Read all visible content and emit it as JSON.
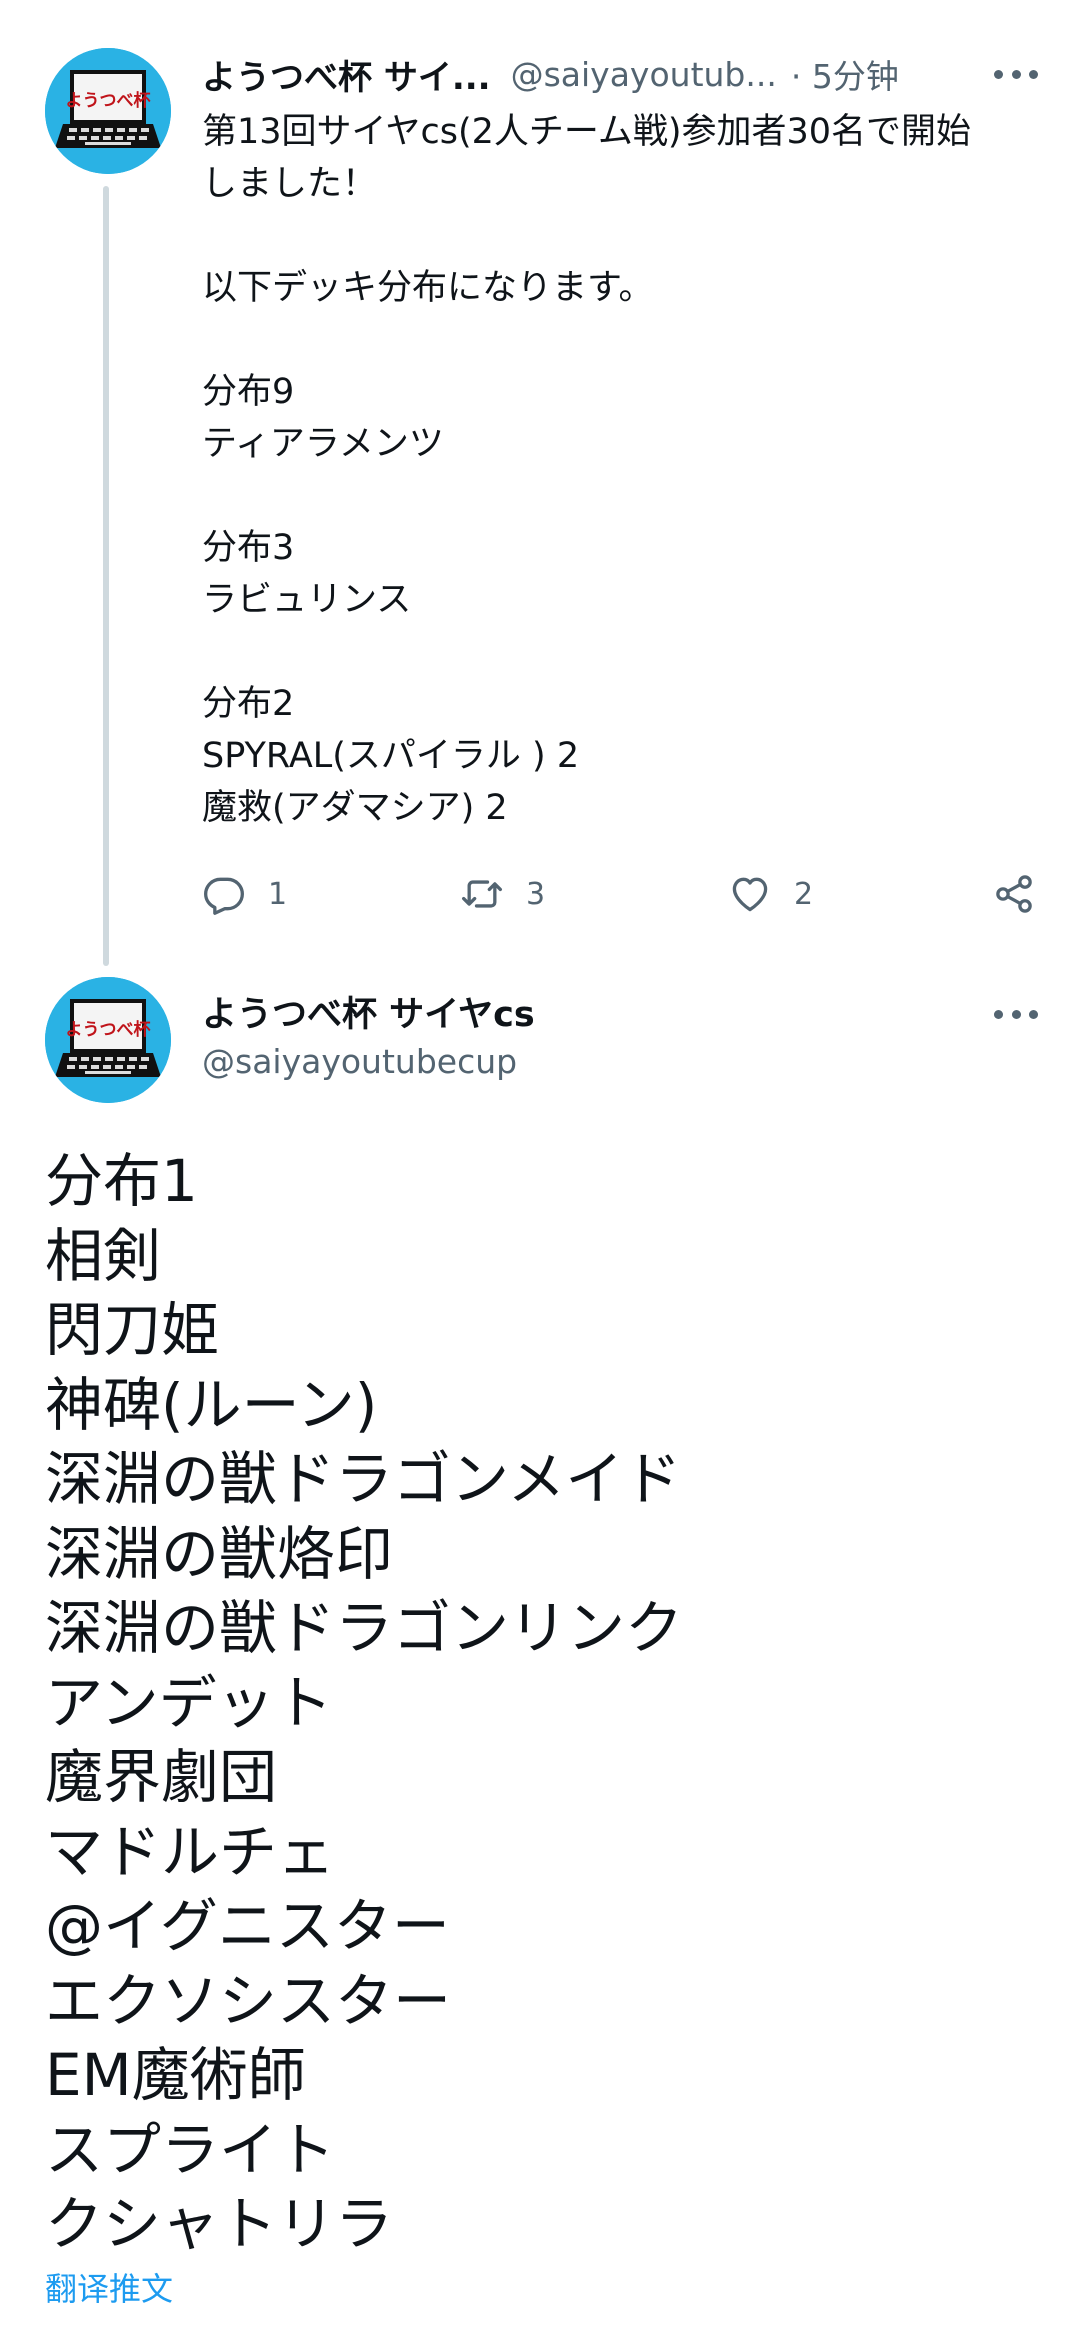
{
  "tweet1": {
    "author_name": "ようつべ杯 サイ...",
    "handle": "@saiyayoutub...",
    "time": "· 5分钟",
    "body_lines": [
      "第13回サイヤcs(2人チーム戦)参加者30名で開始",
      "しました！",
      "",
      "以下デッキ分布になります。",
      "",
      "分布9",
      "ティアラメンツ",
      "",
      "分布3",
      "ラビュリンス",
      "",
      "分布2",
      "SPYRAL(スパイラル ) 2",
      "魔救(アダマシア) 2"
    ],
    "replies": "1",
    "retweets": "3",
    "likes": "2"
  },
  "tweet2": {
    "author_name": "ようつべ杯 サイヤcs",
    "handle": "@saiyayoutubecup",
    "body_lines": [
      "分布1",
      "相剣",
      "閃刀姫",
      "神碑(ルーン)",
      "深淵の獣ドラゴンメイド",
      "深淵の獣烙印",
      "深淵の獣ドラゴンリンク",
      "アンデット",
      "魔界劇団",
      "マドルチェ",
      "@イグニスター",
      "エクソシスター",
      "EM魔術師",
      "スプライト",
      "クシャトリラ"
    ],
    "translate_label": "翻译推文"
  },
  "avatar_text": "ようつべ杯",
  "icons": {
    "reply": "reply-icon",
    "retweet": "retweet-icon",
    "like": "heart-icon",
    "share": "share-icon",
    "more": "more-icon"
  },
  "colors": {
    "accent": "#1d9bf0",
    "secondary_text": "#536471",
    "thread_line": "#cfd9de",
    "avatar_bg": "#2ab2e4"
  }
}
